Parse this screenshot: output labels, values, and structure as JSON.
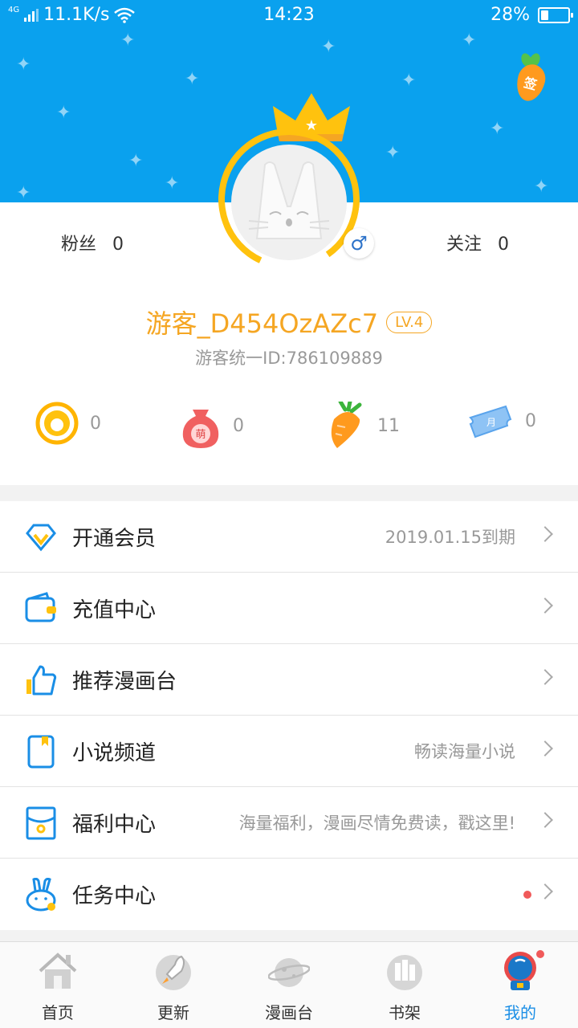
{
  "status_bar": {
    "network": "4G",
    "speed": "11.1K/s",
    "time": "14:23",
    "battery": "28%",
    "battery_level": 0.28
  },
  "header": {
    "sign_label": "签",
    "bg_color": "#0aa1ee"
  },
  "profile": {
    "fans_label": "粉丝",
    "fans_count": "0",
    "follow_label": "关注",
    "follow_count": "0",
    "username": "游客_D454OzAZc7",
    "level": "LV.4",
    "uid": "游客统一ID:786109889",
    "gender_icon": "male-icon"
  },
  "assets": [
    {
      "icon": "coin-icon",
      "value": "0"
    },
    {
      "icon": "meng-bag-icon",
      "label": "萌",
      "value": "0"
    },
    {
      "icon": "carrot-icon",
      "value": "11"
    },
    {
      "icon": "monthly-ticket-icon",
      "label": "月",
      "value": "0"
    }
  ],
  "menu": [
    {
      "label": "开通会员",
      "hint": "2019.01.15到期",
      "icon": "vip-diamond-icon"
    },
    {
      "label": "充值中心",
      "hint": "",
      "icon": "wallet-icon"
    },
    {
      "label": "推荐漫画台",
      "hint": "",
      "icon": "thumbs-up-icon"
    },
    {
      "label": "小说频道",
      "hint": "畅读海量小说",
      "icon": "book-icon"
    },
    {
      "label": "福利中心",
      "hint": "海量福利，漫画尽情免费读，戳这里!",
      "icon": "envelope-icon"
    },
    {
      "label": "任务中心",
      "hint": "",
      "icon": "rabbit-task-icon",
      "has_dot": true
    }
  ],
  "nav": [
    {
      "label": "首页",
      "icon": "home-icon"
    },
    {
      "label": "更新",
      "icon": "rocket-icon"
    },
    {
      "label": "漫画台",
      "icon": "planet-icon"
    },
    {
      "label": "书架",
      "icon": "bookshelf-icon"
    },
    {
      "label": "我的",
      "icon": "astronaut-icon",
      "active": true,
      "has_dot": true
    }
  ],
  "colors": {
    "accent": "#f5a623",
    "link_blue": "#1a8ee6",
    "badge_red": "#f05a5a"
  }
}
